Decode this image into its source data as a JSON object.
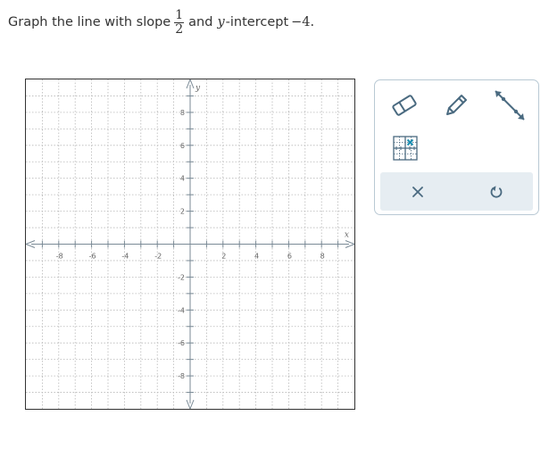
{
  "problem": {
    "text_before": "Graph the line with slope",
    "slope_numerator": "1",
    "slope_denominator": "2",
    "text_middle": "and",
    "variable": "y",
    "text_after": "-intercept",
    "intercept_value": "−4."
  },
  "graph": {
    "x_axis_label": "x",
    "y_axis_label": "y",
    "x_range": [
      -10,
      10
    ],
    "y_range": [
      -10,
      10
    ],
    "grid_step": 1,
    "x_tick_labels": [
      "-8",
      "-6",
      "-4",
      "-2",
      "2",
      "4",
      "6",
      "8"
    ],
    "y_tick_labels": [
      "8",
      "6",
      "4",
      "2",
      "-2",
      "-4",
      "-6",
      "-8"
    ],
    "grid": true,
    "grid_style": "dotted"
  },
  "toolbar": {
    "tools": [
      {
        "name": "eraser",
        "icon": "eraser-icon"
      },
      {
        "name": "pencil",
        "icon": "pencil-icon"
      },
      {
        "name": "line",
        "icon": "line-tool-icon"
      },
      {
        "name": "point",
        "icon": "point-grid-icon"
      }
    ],
    "actions": [
      {
        "name": "clear",
        "icon": "x-icon",
        "glyph": "×"
      },
      {
        "name": "undo",
        "icon": "undo-icon"
      }
    ],
    "icon_color": "#4a6a80",
    "accent_color": "#1a8db0",
    "action_bar_color": "#e6edf2"
  }
}
